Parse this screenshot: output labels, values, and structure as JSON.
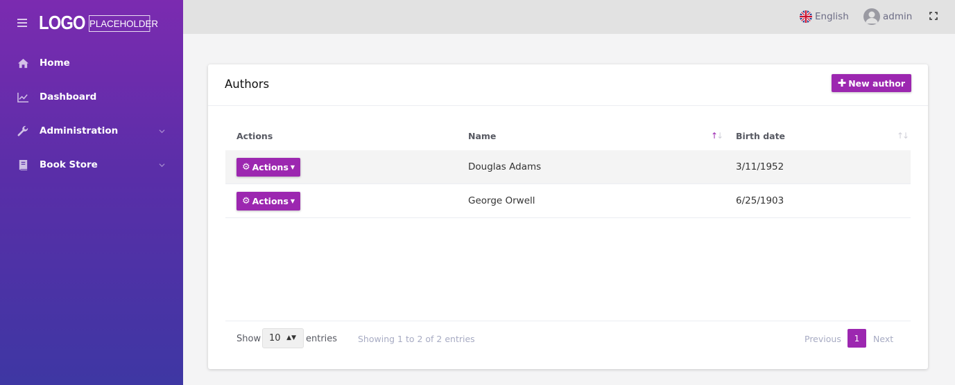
{
  "sidebar": {
    "logo_text": "LOGO",
    "logo_sub": "PLACEHOLDER",
    "items": [
      {
        "label": "Home",
        "icon": "home-icon"
      },
      {
        "label": "Dashboard",
        "icon": "chart-line-icon"
      },
      {
        "label": "Administration",
        "icon": "wrench-icon",
        "has_submenu": true
      },
      {
        "label": "Book Store",
        "icon": "book-icon",
        "has_submenu": true
      }
    ]
  },
  "header": {
    "language": "English",
    "user": "admin"
  },
  "card": {
    "title": "Authors",
    "new_button_label": "New author"
  },
  "table": {
    "columns": [
      "Actions",
      "Name",
      "Birth date"
    ],
    "rows": [
      {
        "action_label": "Actions",
        "name": "Douglas Adams",
        "birth_date": "3/11/1952"
      },
      {
        "action_label": "Actions",
        "name": "George Orwell",
        "birth_date": "6/25/1903"
      }
    ]
  },
  "footer": {
    "show_label": "Show",
    "page_size": "10",
    "entries_label": "entries",
    "info": "Showing 1 to 2 of 2 entries",
    "prev_label": "Previous",
    "current_page": "1",
    "next_label": "Next"
  },
  "colors": {
    "accent": "#9c27b0",
    "sidebar_top": "#7b2bb0",
    "sidebar_bottom": "#3e37a3"
  }
}
